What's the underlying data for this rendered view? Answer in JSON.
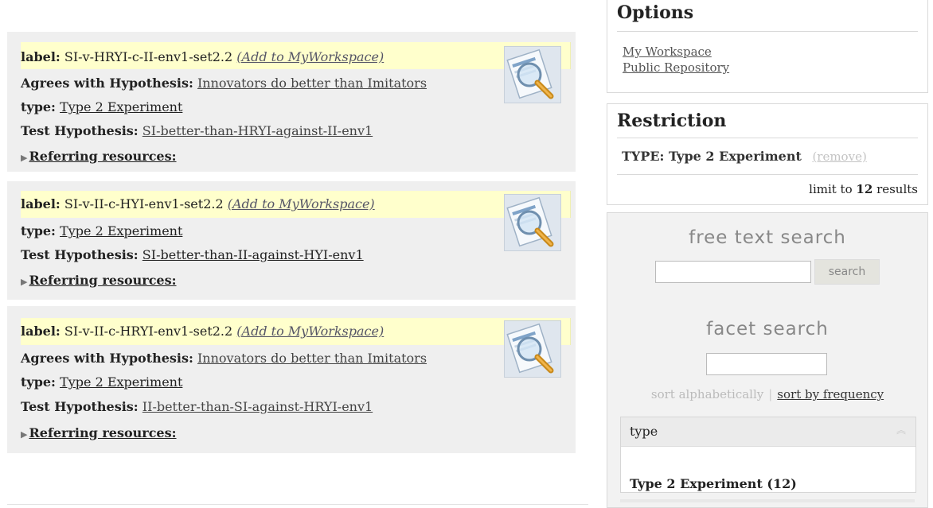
{
  "results": [
    {
      "label_key": "label:",
      "label_value": "SI-v-HRYI-c-II-env1-set2.2",
      "add_link": "(Add to MyWorkspace)",
      "agrees_key": "Agrees with Hypothesis:",
      "agrees_value": "Innovators do better than Imitators",
      "type_key": "type:",
      "type_value": "Type 2 Experiment",
      "test_key": "Test Hypothesis:",
      "test_value": "SI-better-than-HRYI-against-II-env1",
      "referring": "Referring resources:"
    },
    {
      "label_key": "label:",
      "label_value": "SI-v-II-c-HYI-env1-set2.2",
      "add_link": "(Add to MyWorkspace)",
      "type_key": "type:",
      "type_value": "Type 2 Experiment",
      "test_key": "Test Hypothesis:",
      "test_value": "SI-better-than-II-against-HYI-env1",
      "referring": "Referring resources:"
    },
    {
      "label_key": "label:",
      "label_value": "SI-v-II-c-HRYI-env1-set2.2",
      "add_link": "(Add to MyWorkspace)",
      "agrees_key": "Agrees with Hypothesis:",
      "agrees_value": "Innovators do better than Imitators",
      "type_key": "type:",
      "type_value": "Type 2 Experiment",
      "test_key": "Test Hypothesis:",
      "test_value": "II-better-than-SI-against-HRYI-env1",
      "referring": "Referring resources:"
    }
  ],
  "sidebar": {
    "options": {
      "title": "Options",
      "links": [
        "My Workspace",
        "Public Repository"
      ]
    },
    "restriction": {
      "title": "Restriction",
      "line": "TYPE: Type 2 Experiment",
      "remove": "(remove)",
      "limit_prefix": "limit to",
      "limit_count": "12",
      "limit_suffix": "results"
    },
    "free_text": {
      "heading": "free text search",
      "button": "search"
    },
    "facet_search": {
      "heading": "facet search",
      "sort_alpha": "sort alphabetically",
      "sort_freq": "sort by frequency",
      "facet_name": "type",
      "facet_item": "Type 2 Experiment (12)"
    }
  },
  "icons": {
    "thumb": "magnifier-document-icon",
    "triangle": "triangle-right-icon",
    "chevron": "chevron-up-double-icon"
  }
}
